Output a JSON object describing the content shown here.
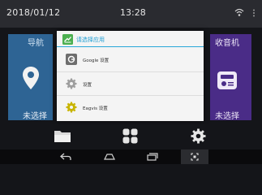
{
  "status_bar": {
    "date": "2018/01/12",
    "time": "13:28"
  },
  "tiles": {
    "navigation": {
      "title": "导航",
      "status": "未选择",
      "icon": "location-pin-icon",
      "color": "#2e6494"
    },
    "radio": {
      "title": "收音机",
      "status": "未选择",
      "icon": "radio-icon",
      "color": "#4a2c87"
    }
  },
  "dialog": {
    "title": "请选择应用",
    "accent": "#1f9ed3",
    "items": [
      {
        "label": "Google 设置",
        "icon": "google-settings-icon"
      },
      {
        "label": "设置",
        "icon": "settings-gear-icon"
      },
      {
        "label": "Eagvis 设置",
        "icon": "eagvis-settings-icon"
      }
    ]
  },
  "dock": {
    "icons": [
      "folder-icon",
      "apps-grid-icon",
      "gear-icon"
    ]
  },
  "nav_bar": {
    "icons": [
      "back-icon",
      "home-icon",
      "recent-apps-icon",
      "screenshot-icon"
    ]
  }
}
